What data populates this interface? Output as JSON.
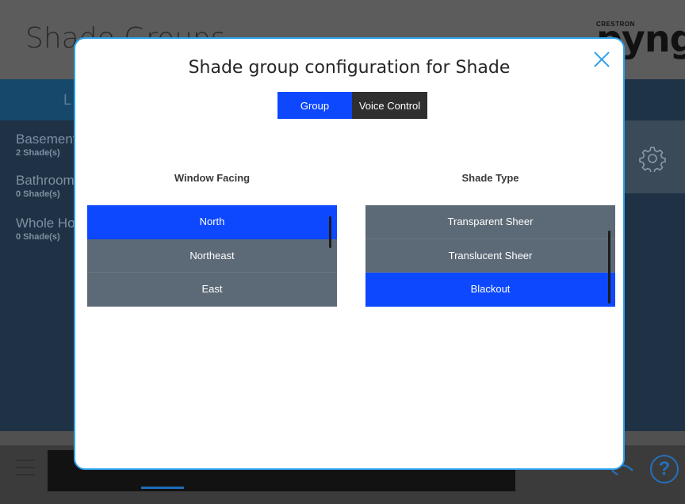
{
  "background": {
    "title": "Shade Groups",
    "logo_small": "CRESTRON",
    "logo": "pyng",
    "tab_label": "L",
    "items": [
      {
        "name": "Basement",
        "count": "2 Shade(s)"
      },
      {
        "name": "Bathroom",
        "count": "0 Shade(s)"
      },
      {
        "name": "Whole House",
        "count": "0 Shade(s)"
      }
    ],
    "icons": {
      "settings": "gear-icon",
      "menu": "hamburger-icon",
      "help": "help-icon",
      "back": "back-arrow-icon"
    },
    "help_label": "?"
  },
  "modal": {
    "title": "Shade group configuration for Shade",
    "close_icon": "close-icon",
    "tabs": [
      {
        "label": "Group",
        "selected": true
      },
      {
        "label": "Voice Control",
        "selected": false
      }
    ],
    "window_facing": {
      "label": "Window Facing",
      "options": [
        "North",
        "Northeast",
        "East"
      ],
      "selected": "North"
    },
    "shade_type": {
      "label": "Shade Type",
      "options": [
        "Transparent Sheer",
        "Translucent Sheer",
        "Blackout"
      ],
      "selected": "Blackout"
    }
  },
  "colors": {
    "accent": "#0d48ff",
    "modal_border": "#2aa1ee",
    "list_bg": "#5c6976"
  }
}
